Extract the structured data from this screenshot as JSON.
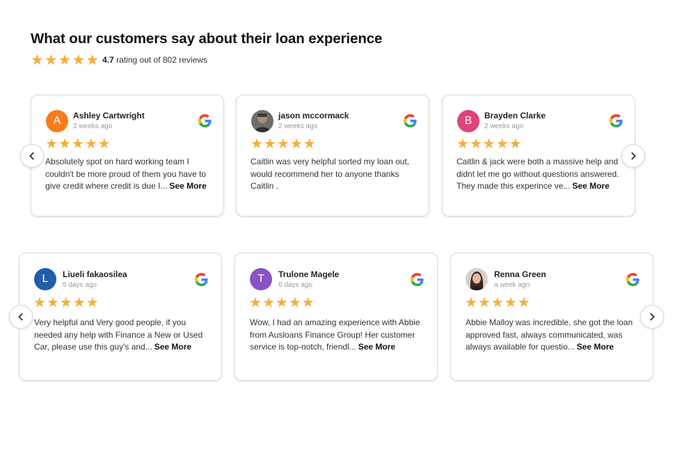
{
  "header": {
    "title": "What our customers say about their loan experience",
    "rating": "4.7",
    "rating_suffix": "rating out of 802 reviews",
    "stars": 5
  },
  "colors": {
    "star": "#f6ad3c",
    "avatar_orange": "#f57c1f",
    "avatar_pink": "#e0427a",
    "avatar_blue": "#1f5fa8",
    "avatar_purple": "#8a52c4"
  },
  "carousel1": {
    "reviews": [
      {
        "name": "Ashley Cartwright",
        "time": "2 weeks ago",
        "initial": "A",
        "avatar": "orange",
        "stars": 5,
        "text": "Absolutely spot on hard working team I couldn't be more proud of them you have to give credit where credit is due I...",
        "see_more": "See More"
      },
      {
        "name": "jason mccormack",
        "time": "2 weeks ago",
        "initial": "",
        "avatar": "photo",
        "stars": 5,
        "text": "Caitlin was very helpful sorted my loan out, would recommend her to anyone thanks Caitlin .",
        "see_more": ""
      },
      {
        "name": "Brayden Clarke",
        "time": "2 weeks ago",
        "initial": "B",
        "avatar": "pink",
        "stars": 5,
        "text": "Caitlin & jack were both a massive help and didnt let me go without questions answered. They made this experince ve...",
        "see_more": "See More"
      }
    ]
  },
  "carousel2": {
    "reviews": [
      {
        "name": "Liueli fakaosilea",
        "time": "5 days ago",
        "initial": "L",
        "avatar": "blue",
        "stars": 5,
        "text": "Very helpful and Very good people, if you needed any help with Finance a New or Used Car, please use this guy's and...",
        "see_more": "See More"
      },
      {
        "name": "Trulone Magele",
        "time": "6 days ago",
        "initial": "T",
        "avatar": "purple",
        "stars": 5,
        "text": "Wow, I had an amazing experience with Abbie from Ausloans Finance Group! Her customer service is top-notch, friendl...",
        "see_more": "See More"
      },
      {
        "name": "Renna Green",
        "time": "a week ago",
        "initial": "",
        "avatar": "photo",
        "stars": 5,
        "text": "Abbie Malloy was incredible, she got the loan approved fast, always communicated, was always available for questio...",
        "see_more": "See More"
      }
    ]
  },
  "icons": {
    "google": "google-g-icon",
    "prev": "chevron-left-icon",
    "next": "chevron-right-icon",
    "star": "star-icon"
  }
}
